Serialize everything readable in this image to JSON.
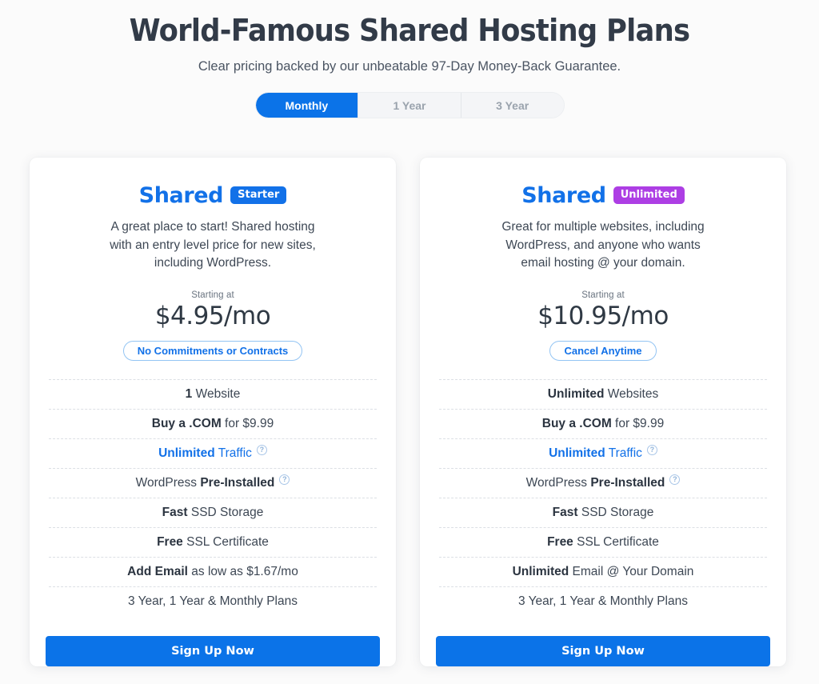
{
  "hero": {
    "title": "World-Famous Shared Hosting Plans",
    "subtitle": "Clear pricing backed by our unbeatable 97-Day Money-Back Guarantee."
  },
  "term_toggle": {
    "options": [
      {
        "label": "Monthly",
        "active": true
      },
      {
        "label": "1 Year",
        "active": false
      },
      {
        "label": "3 Year",
        "active": false
      }
    ],
    "active_color": "#0b73e8",
    "inactive_bg": "#f4f5f7",
    "inactive_text": "#9aa3ad"
  },
  "plans": [
    {
      "name": "Shared",
      "badge": "Starter",
      "badge_color": "#1271e8",
      "description": "A great place to start! Shared hosting with an entry level price for new sites, including WordPress.",
      "price_label": "Starting at",
      "price": "$4.95/mo",
      "guarantee_pill": "No Commitments or Contracts",
      "features": [
        {
          "strong": "1",
          "rest": " Website",
          "help": false,
          "blue": false
        },
        {
          "strong": "Buy a .COM",
          "rest": " for $9.99",
          "help": false,
          "blue": false
        },
        {
          "strong": "Unlimited",
          "rest": " Traffic",
          "help": true,
          "blue": true
        },
        {
          "strong": "",
          "rest": "WordPress ",
          "strong_after": "Pre-Installed",
          "help": true,
          "blue": false
        },
        {
          "strong": "Fast",
          "rest": " SSD Storage",
          "help": false,
          "blue": false
        },
        {
          "strong": "Free",
          "rest": " SSL Certificate",
          "help": false,
          "blue": false
        },
        {
          "strong": "Add Email",
          "rest": " as low as $1.67/mo",
          "help": false,
          "blue": false
        },
        {
          "strong": "",
          "rest": "3 Year, 1 Year & Monthly Plans",
          "help": false,
          "blue": false
        }
      ],
      "cta": "Sign Up Now"
    },
    {
      "name": "Shared",
      "badge": "Unlimited",
      "badge_color": "#ad3ee4",
      "description": "Great for multiple websites, including WordPress, and anyone who wants email hosting @ your domain.",
      "price_label": "Starting at",
      "price": "$10.95/mo",
      "guarantee_pill": "Cancel Anytime",
      "features": [
        {
          "strong": "Unlimited",
          "rest": " Websites",
          "help": false,
          "blue": false
        },
        {
          "strong": "Buy a .COM",
          "rest": " for $9.99",
          "help": false,
          "blue": false
        },
        {
          "strong": "Unlimited",
          "rest": " Traffic",
          "help": true,
          "blue": true
        },
        {
          "strong": "",
          "rest": "WordPress ",
          "strong_after": "Pre-Installed",
          "help": true,
          "blue": false
        },
        {
          "strong": "Fast",
          "rest": " SSD Storage",
          "help": false,
          "blue": false
        },
        {
          "strong": "Free",
          "rest": " SSL Certificate",
          "help": false,
          "blue": false
        },
        {
          "strong": "Unlimited",
          "rest": " Email @ Your Domain",
          "help": false,
          "blue": false
        },
        {
          "strong": "",
          "rest": "3 Year, 1 Year & Monthly Plans",
          "help": false,
          "blue": false
        }
      ],
      "cta": "Sign Up Now"
    }
  ],
  "icons": {
    "help": "?"
  }
}
